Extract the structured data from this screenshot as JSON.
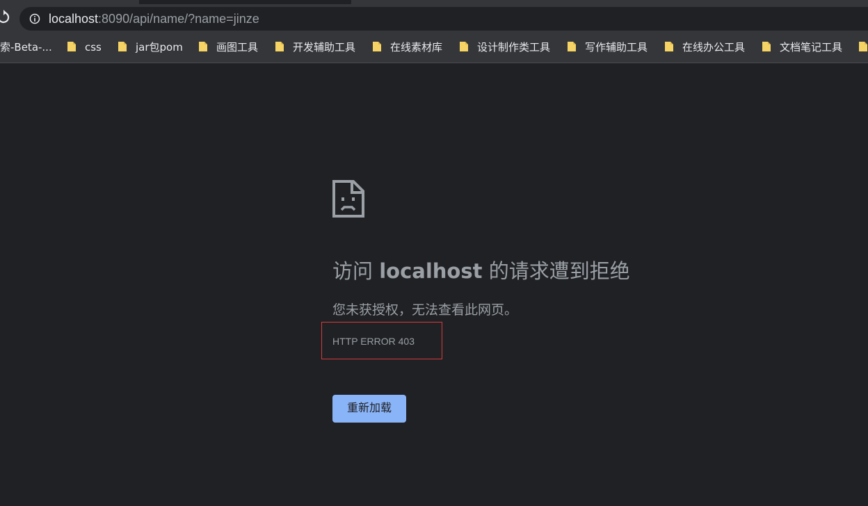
{
  "address_bar": {
    "url_host": "localhost",
    "url_path": ":8090/api/name/?name=jinze",
    "icons": {
      "reload": "reload-icon",
      "info": "info-icon"
    }
  },
  "bookmarks": {
    "items": [
      {
        "label": "索-Beta-...",
        "icon": ""
      },
      {
        "label": "css",
        "icon": "folder-icon"
      },
      {
        "label": "jar包pom",
        "icon": "folder-icon"
      },
      {
        "label": "画图工具",
        "icon": "folder-icon"
      },
      {
        "label": "开发辅助工具",
        "icon": "folder-icon"
      },
      {
        "label": "在线素材库",
        "icon": "folder-icon"
      },
      {
        "label": "设计制作类工具",
        "icon": "folder-icon"
      },
      {
        "label": "写作辅助工具",
        "icon": "folder-icon"
      },
      {
        "label": "在线办公工具",
        "icon": "folder-icon"
      },
      {
        "label": "文档笔记工具",
        "icon": "folder-icon"
      },
      {
        "label": "",
        "icon": "folder-icon"
      }
    ]
  },
  "error_page": {
    "icon": "sad-page-icon",
    "title_prefix": "访问 ",
    "title_host": "localhost",
    "title_suffix": " 的请求遭到拒绝",
    "description": "您未获授权，无法查看此网页。",
    "error_code": "HTTP ERROR 403",
    "reload_label": "重新加载"
  },
  "colors": {
    "background": "#202124",
    "toolbar": "#35363a",
    "text_secondary": "#9aa0a6",
    "button": "#8ab4f8",
    "highlight_box": "#d93a3a",
    "folder": "#f6d365"
  }
}
